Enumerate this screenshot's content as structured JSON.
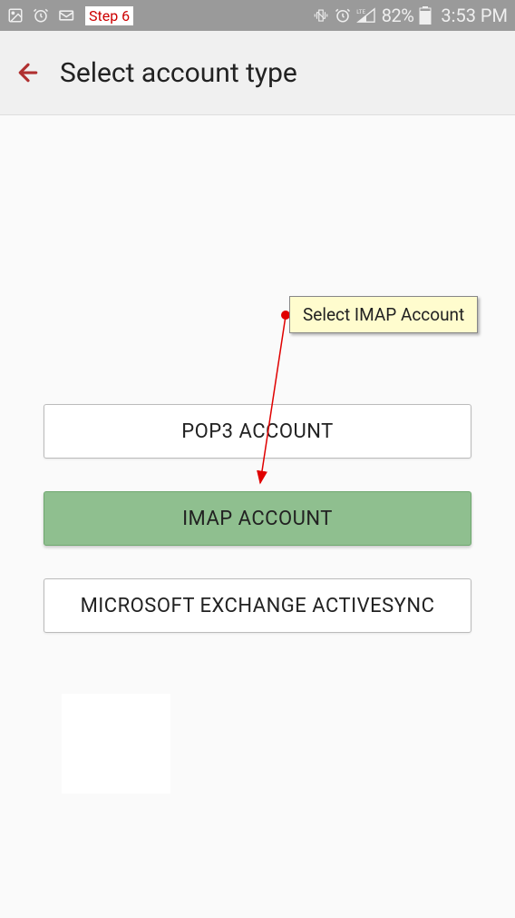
{
  "status_bar": {
    "step_label": "Step 6",
    "battery": "82%",
    "time": "3:53 PM"
  },
  "app_bar": {
    "title": "Select account type"
  },
  "options": {
    "pop3": "POP3 ACCOUNT",
    "imap": "IMAP ACCOUNT",
    "exchange": "MICROSOFT EXCHANGE ACTIVESYNC"
  },
  "annotation": {
    "text": "Select IMAP Account"
  }
}
